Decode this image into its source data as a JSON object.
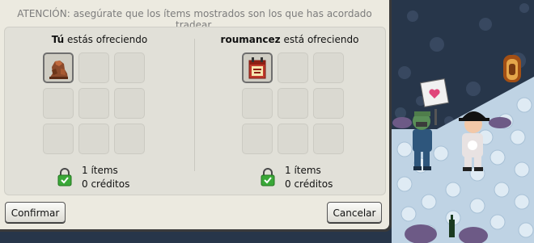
{
  "trade": {
    "warning": "ATENCIÓN: asegúrate que los ítems mostrados son los que has acordado tradear.",
    "left": {
      "owner_bold": "Tú",
      "owner_rest": " estás ofreciendo",
      "items_line": "1 ítems",
      "credits_line": "0 créditos",
      "slot_icons": [
        "rock-statue-item-icon",
        "",
        "",
        "",
        "",
        "",
        "",
        "",
        ""
      ]
    },
    "right": {
      "owner_bold": "roumancez",
      "owner_rest": " está ofreciendo",
      "items_line": "1 ítems",
      "credits_line": "0 créditos",
      "slot_icons": [
        "hc-calendar-item-icon",
        "",
        "",
        "",
        "",
        "",
        "",
        "",
        ""
      ]
    },
    "confirm_label": "Confirmar",
    "cancel_label": "Cancelar"
  },
  "room": {
    "sign_icon": "heart-sign-icon",
    "door_icon": "arched-door-icon"
  },
  "colors": {
    "dialog_bg": "#eceae0",
    "panel_bg": "#e1e0d8",
    "lock_green": "#3aa838",
    "room_ice": "#c9dbe9",
    "room_night": "#27364a"
  }
}
